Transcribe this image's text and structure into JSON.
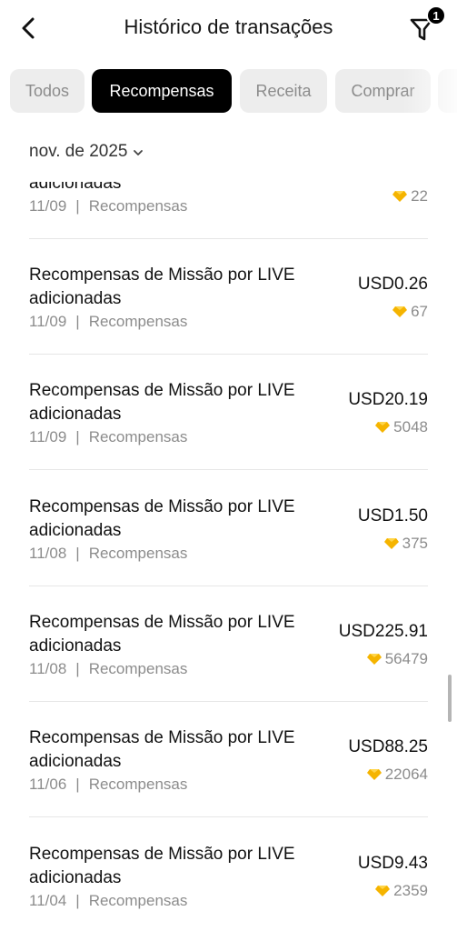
{
  "header": {
    "title": "Histórico de transações",
    "filter_count": "1"
  },
  "tabs": [
    {
      "label": "Todos",
      "active": false
    },
    {
      "label": "Recompensas",
      "active": true
    },
    {
      "label": "Receita",
      "active": false
    },
    {
      "label": "Comprar",
      "active": false
    }
  ],
  "month_selector": {
    "label": "nov. de 2025"
  },
  "colors": {
    "accent": "#000000",
    "diamond": "#F5B400",
    "muted_text": "#8C8C8C",
    "tab_bg": "#EDEDED"
  },
  "transactions": [
    {
      "title": "adicionadas",
      "date": "11/09",
      "category": "Recompensas",
      "usd": "",
      "diamonds": "22"
    },
    {
      "title": "Recompensas de Missão por LIVE adicionadas",
      "date": "11/09",
      "category": "Recompensas",
      "usd": "USD0.26",
      "diamonds": "67"
    },
    {
      "title": "Recompensas de Missão por LIVE adicionadas",
      "date": "11/09",
      "category": "Recompensas",
      "usd": "USD20.19",
      "diamonds": "5048"
    },
    {
      "title": "Recompensas de Missão por LIVE adicionadas",
      "date": "11/08",
      "category": "Recompensas",
      "usd": "USD1.50",
      "diamonds": "375"
    },
    {
      "title": "Recompensas de Missão por LIVE adicionadas",
      "date": "11/08",
      "category": "Recompensas",
      "usd": "USD225.91",
      "diamonds": "56479"
    },
    {
      "title": "Recompensas de Missão por LIVE adicionadas",
      "date": "11/06",
      "category": "Recompensas",
      "usd": "USD88.25",
      "diamonds": "22064"
    },
    {
      "title": "Recompensas de Missão por LIVE adicionadas",
      "date": "11/04",
      "category": "Recompensas",
      "usd": "USD9.43",
      "diamonds": "2359"
    }
  ],
  "icons": {
    "back": "chevron-left-icon",
    "filter": "filter-funnel-icon",
    "diamond": "diamond-icon",
    "dropdown": "chevron-down-icon"
  }
}
